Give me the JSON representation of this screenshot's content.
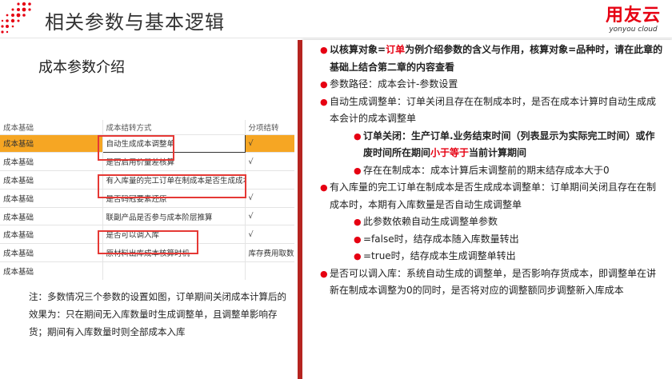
{
  "header": {
    "title": "相关参数与基本逻辑",
    "logo_cn": "用友云",
    "logo_en": "yonyou cloud"
  },
  "subtitle": "成本参数介绍",
  "table": {
    "headers": [
      "成本基础",
      "成本结转方式",
      "分项结转"
    ],
    "rows": [
      {
        "c1": "成本基础",
        "c2": "自动生成成本调整单",
        "c3": "√",
        "highlight": true
      },
      {
        "c1": "成本基础",
        "c2": "是否启用价量差核算",
        "c3": "√"
      },
      {
        "c1": "成本基础",
        "c2": "有入库量的完工订单在制成本是否生成成本...",
        "c3": ""
      },
      {
        "c1": "成本基础",
        "c2": "是否码冠要素还原",
        "c3": "√"
      },
      {
        "c1": "成本基础",
        "c2": "联副产品是否参与成本阶层推算",
        "c3": "√"
      },
      {
        "c1": "成本基础",
        "c2": "是否可以调入库",
        "c3": "√"
      },
      {
        "c1": "成本基础",
        "c2": "原材料出库成本核算时机",
        "c3": "库存费用取数"
      },
      {
        "c1": "成本基础",
        "c2": "",
        "c3": ""
      }
    ]
  },
  "note": "注：多数情况三个参数的设置如图，订单期间关闭成本计算后的效果为：只在期间无入库数量时生成调整单，且调整单影响存货；期间有入库数量时则全部成本入库",
  "bullets": {
    "b1_pre": "以核算对象=",
    "b1_red": "订单",
    "b1_post": "为例介绍参数的含义与作用，核算对象=品种时，请在此章的基础上结合第二章的内容查看",
    "b2": "参数路径：成本会计-参数设置",
    "b3": "自动生成调整单：订单关闭且存在在制成本时，是否在成本计算时自动生成成本会计的成本调整单",
    "b4_pre": "订单关闭：生产订单.业务结束时间（列表显示为实际完工时间）或作废时间所在期间",
    "b4_red": "小于等于",
    "b4_post": "当前计算期间",
    "b5": "存在在制成本：成本计算后末调整前的期末结存成本大于0",
    "b6": "有入库量的完工订单在制成本是否生成成本调整单：订单期间关闭且存在在制成本时，本期有入库数量是否自动生成调整单",
    "b7": "此参数依赖自动生成调整单参数",
    "b8": "=false时，结存成本随入库数量转出",
    "b9": "=true时，结存成本生成调整单转出",
    "b10": "是否可以调入库：系统自动生成的调整单，是否影响存货成本，即调整单在讲新在制成本调整为0的同时，是否将对应的调整额同步调整新入库成本"
  },
  "colors": {
    "accent_red": "#e60012",
    "panel_edge": "#b52420",
    "highlight_row": "#f6a623"
  }
}
